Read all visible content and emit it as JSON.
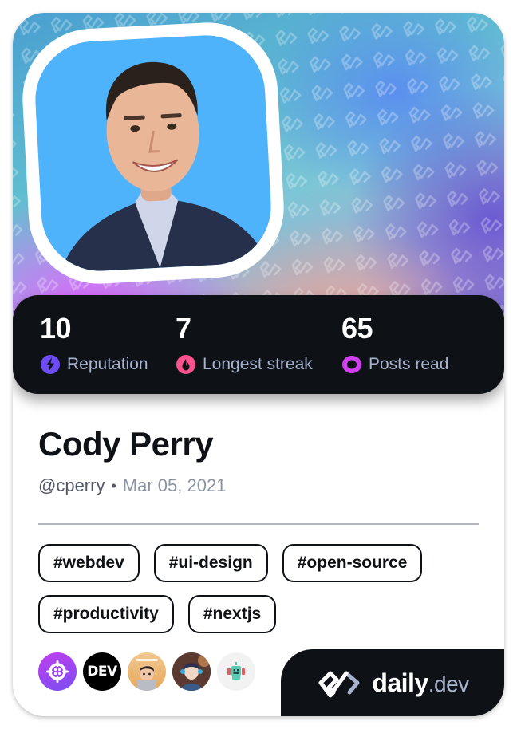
{
  "profile": {
    "name": "Cody Perry",
    "handle": "@cperry",
    "separator": "•",
    "joined": "Mar 05, 2021"
  },
  "stats": [
    {
      "value": "10",
      "label": "Reputation",
      "icon": "lightning-icon",
      "color": "#6c4cf5"
    },
    {
      "value": "7",
      "label": "Longest streak",
      "icon": "flame-icon",
      "color": "#fc538d"
    },
    {
      "value": "65",
      "label": "Posts read",
      "icon": "ring-icon",
      "color": "#d23ff0"
    }
  ],
  "tags": [
    "#webdev",
    "#ui-design",
    "#open-source",
    "#productivity",
    "#nextjs"
  ],
  "sources": [
    {
      "name": "crosshair-source",
      "icon": "crosshair-icon"
    },
    {
      "name": "dev-to-source",
      "label": "DEV"
    },
    {
      "name": "memoji-source",
      "icon": "memoji-avatar"
    },
    {
      "name": "anime-gamer-source",
      "icon": "anime-avatar"
    },
    {
      "name": "robot-source",
      "icon": "robot-icon"
    }
  ],
  "brand": {
    "name": "daily",
    "suffix": ".dev"
  },
  "colors": {
    "dark": "#0e1217",
    "label": "#a8b3cf",
    "reputation": "#6c4cf5",
    "streak": "#fc538d",
    "posts": "#d23ff0"
  }
}
